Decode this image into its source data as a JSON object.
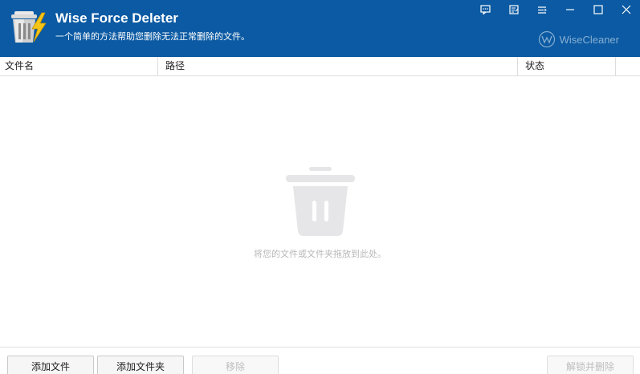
{
  "app": {
    "title": "Wise Force Deleter",
    "subtitle": "一个简单的方法帮助您删除无法正常删除的文件。",
    "brand": "WiseCleaner"
  },
  "window_controls": [
    {
      "name": "feedback-icon"
    },
    {
      "name": "notes-icon"
    },
    {
      "name": "menu-icon"
    },
    {
      "name": "minimize-icon"
    },
    {
      "name": "maximize-icon"
    },
    {
      "name": "close-icon"
    }
  ],
  "list": {
    "columns": [
      "文件名",
      "路径",
      "状态"
    ],
    "empty_text": "将您的文件或文件夹拖放到此处。"
  },
  "buttons": {
    "add_file": "添加文件",
    "add_folder": "添加文件夹",
    "remove": "移除",
    "unlock_delete": "解锁并删除"
  },
  "colors": {
    "titlebar": "#0b5aa3",
    "accent_bolt": "#f5c518"
  }
}
